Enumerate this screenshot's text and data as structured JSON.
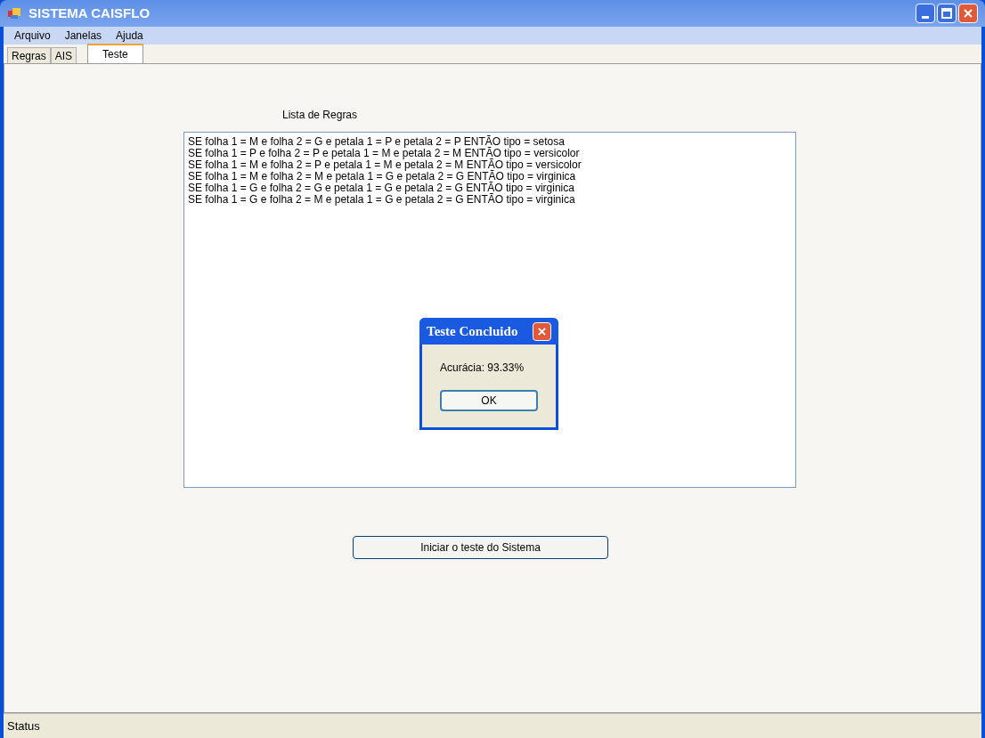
{
  "window": {
    "title": "SISTEMA CAISFLO"
  },
  "menu": [
    "Arquivo",
    "Janelas",
    "Ajuda"
  ],
  "tabs": [
    {
      "label": "Regras",
      "selected": false
    },
    {
      "label": "AIS",
      "selected": false
    },
    {
      "label": "Teste",
      "selected": true
    }
  ],
  "rules_list": {
    "label": "Lista de Regras",
    "items": [
      "SE folha 1 = M e folha 2 = G e petala 1 = P e petala 2 = P ENTÃO tipo = setosa",
      "SE folha 1 = P e folha 2 = P e petala 1 = M e petala 2 = M ENTÃO tipo = versicolor",
      "SE folha 1 = M e folha 2 = P e petala 1 = M e petala 2 = M ENTÃO tipo = versicolor",
      "SE folha 1 = M e folha 2 = M e petala 1 = G e petala 2 = G ENTÃO tipo = virginica",
      "SE folha 1 = G e folha 2 = G e petala 1 = G e petala 2 = G ENTÃO tipo = virginica",
      "SE folha 1 = G e folha 2 = M e petala 1 = G e petala 2 = G ENTÃO tipo = virginica"
    ]
  },
  "dialog": {
    "title": "Teste Concluido",
    "message": "Acurácia: 93.33%",
    "button": "OK"
  },
  "start_button": "Iniciar o teste do Sistema",
  "status_bar": "Status"
}
